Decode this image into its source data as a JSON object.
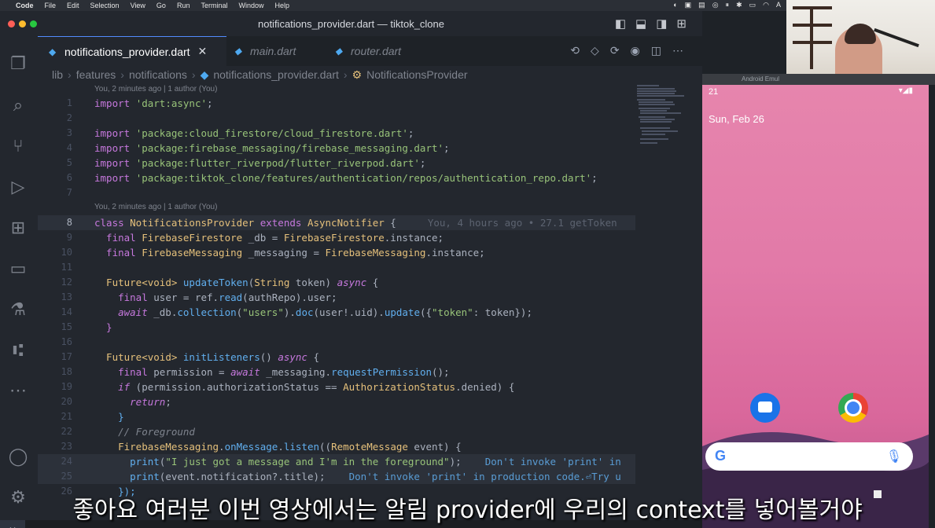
{
  "menubar": {
    "app": "Code",
    "menus": [
      "File",
      "Edit",
      "Selection",
      "View",
      "Go",
      "Run",
      "Terminal",
      "Window",
      "Help"
    ]
  },
  "window": {
    "title": "notifications_provider.dart — tiktok_clone"
  },
  "tabs": [
    {
      "label": "notifications_provider.dart",
      "active": true
    },
    {
      "label": "main.dart",
      "active": false
    },
    {
      "label": "router.dart",
      "active": false
    }
  ],
  "breadcrumb": [
    "lib",
    "features",
    "notifications",
    "notifications_provider.dart",
    "NotificationsProvider"
  ],
  "codelens": {
    "top": "You, 2 minutes ago | 1 author (You)",
    "class": "You, 2 minutes ago | 1 author (You)"
  },
  "code": {
    "l1": [
      "import ",
      "'dart:async'",
      ";"
    ],
    "l3": [
      "import ",
      "'package:cloud_firestore/cloud_firestore.dart'",
      ";"
    ],
    "l4": [
      "import ",
      "'package:firebase_messaging/firebase_messaging.dart'",
      ";"
    ],
    "l5": [
      "import ",
      "'package:flutter_riverpod/flutter_riverpod.dart'",
      ";"
    ],
    "l6": [
      "import ",
      "'package:tiktok_clone/features/authentication/repos/authentication_repo.dart'",
      ";"
    ],
    "l8": [
      "class ",
      "NotificationsProvider",
      " extends ",
      "AsyncNotifier",
      " {"
    ],
    "l8_blame": "You, 4 hours ago • 27.1 getToken",
    "l9": [
      "  final ",
      "FirebaseFirestore",
      " _db = ",
      "FirebaseFirestore",
      ".instance;"
    ],
    "l10": [
      "  final ",
      "FirebaseMessaging",
      " _messaging = ",
      "FirebaseMessaging",
      ".instance;"
    ],
    "l12": [
      "  Future",
      "<void>",
      " updateToken",
      "(",
      "String",
      " token) ",
      "async",
      " {"
    ],
    "l13": [
      "    final ",
      "user = ref.",
      "read",
      "(authRepo).user;"
    ],
    "l14": [
      "    await",
      " _db.",
      "collection",
      "(",
      "\"users\"",
      ").",
      "doc",
      "(user!.uid).",
      "update",
      "({",
      "\"token\"",
      ": token});"
    ],
    "l15": [
      "  }"
    ],
    "l17": [
      "  Future",
      "<void>",
      " initListeners",
      "() ",
      "async",
      " {"
    ],
    "l18": [
      "    final ",
      "permission = ",
      "await",
      " _messaging.",
      "requestPermission",
      "();"
    ],
    "l19": [
      "    if",
      " (permission.authorizationStatus == ",
      "AuthorizationStatus",
      ".denied) {"
    ],
    "l20": [
      "      return",
      ";"
    ],
    "l21": [
      "    }"
    ],
    "l22": [
      "    // Foreground"
    ],
    "l23": [
      "    FirebaseMessaging",
      ".",
      "onMessage",
      ".",
      "listen",
      "((",
      "RemoteMessage",
      " event) {"
    ],
    "l24": [
      "      print",
      "(",
      "\"I just got a message and I'm in the foreground\"",
      ");",
      "    Don't invoke 'print' in"
    ],
    "l25": [
      "      print",
      "(event.notification?.title);",
      "    Don't invoke 'print' in production code.⏎Try u"
    ],
    "l26": [
      "    });"
    ]
  },
  "emulator": {
    "title": "Android Emul",
    "time": "21",
    "date": "Sun, Feb 26",
    "search_logo": "G"
  },
  "subtitle": "좋아요 여러분 이번 영상에서는 알림 provider에 우리의 context를 넣어볼거야",
  "colors": {
    "accent": "#528bff",
    "editor_bg": "#23272e"
  }
}
